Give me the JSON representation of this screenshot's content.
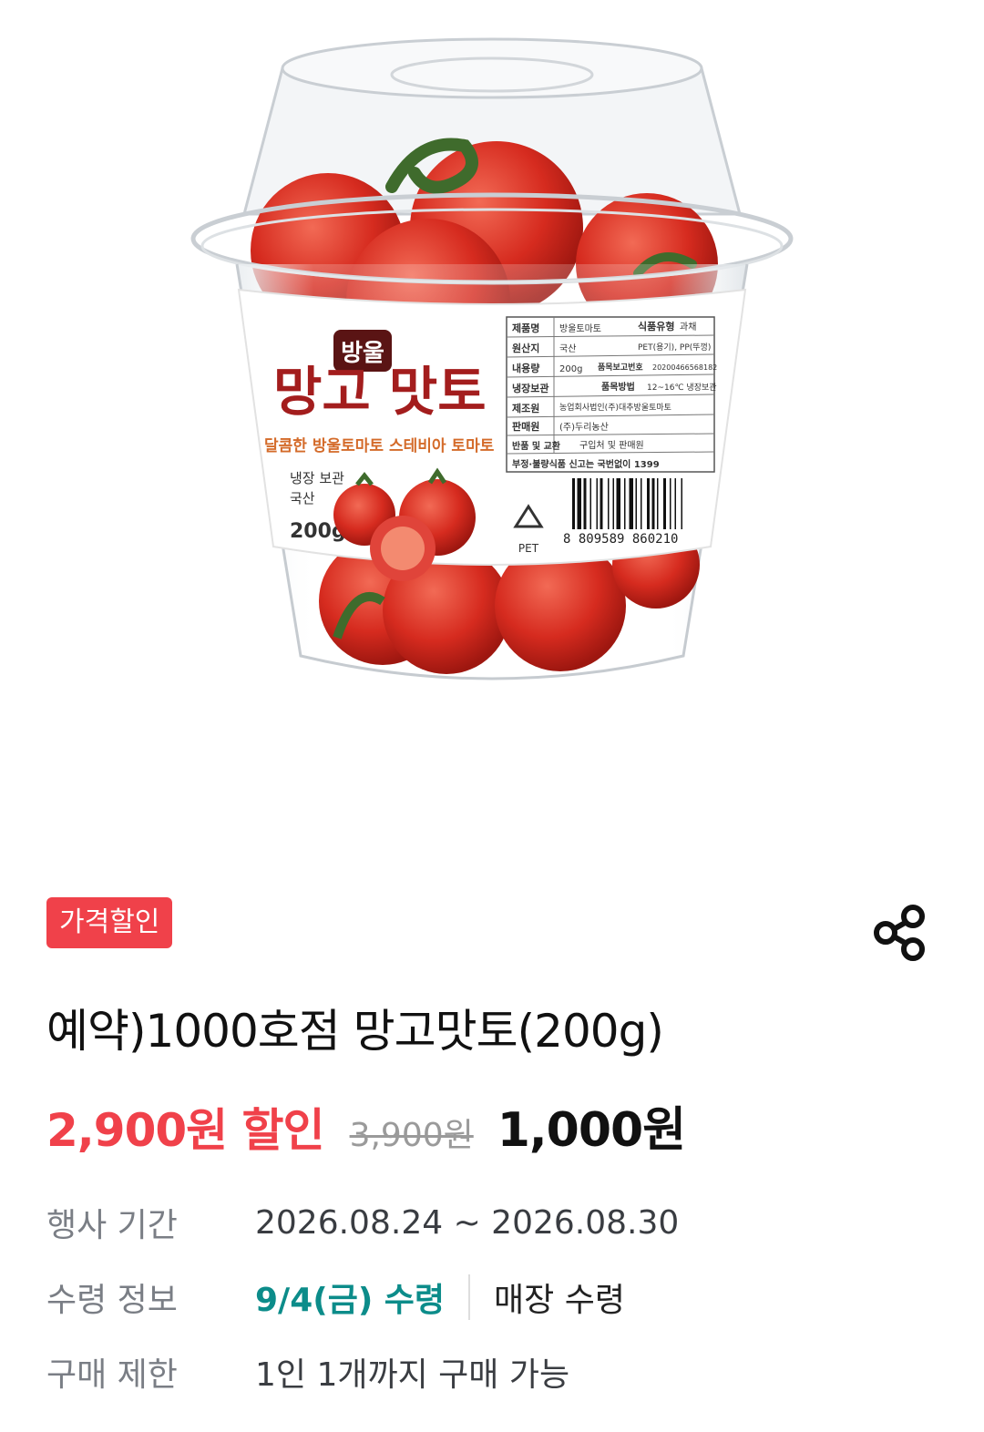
{
  "product_image": {
    "alt": "방울 망고 맛토 200g",
    "label": {
      "small_title": "방울",
      "brand": "망고 맛토",
      "tagline": "달콤한 방울토마토 스테비아 토마토",
      "storage": "냉장 보관",
      "origin": "국산",
      "weight": "200g",
      "barcode_number": "8 809589 860210",
      "recycle_mark": "PET",
      "info_table": [
        [
          "제품명",
          "방울토마토",
          "식품유형",
          "과채"
        ],
        [
          "원산지",
          "국산",
          "",
          "PET(용기), PP(뚜껑)"
        ],
        [
          "내용량",
          "200g",
          "품목보고번호",
          "20200466568182"
        ],
        [
          "냉장보관",
          "",
          "품목방법",
          "12~16℃ 냉장보관"
        ],
        [
          "제조원",
          "농업회사법인(주)대추방울토마토",
          "",
          ""
        ],
        [
          "판매원",
          "(주)두리농산",
          "",
          ""
        ],
        [
          "반품 및 교환",
          "구입처 및 판매원",
          "",
          ""
        ],
        [
          "부정·불량식품 신고는 국번없이 1399",
          "",
          "",
          ""
        ]
      ]
    }
  },
  "badge": "가격할인",
  "share_icon": "share-icon",
  "title": "예약)1000호점 망고맛토(200g)",
  "price": {
    "discount": "2,900원 할인",
    "original": "3,900원",
    "final": "1,000원"
  },
  "info": {
    "period_label": "행사 기간",
    "period_value": "2026.08.24 ~ 2026.08.30",
    "pickup_label": "수령 정보",
    "pickup_date": "9/4(금) 수령",
    "pickup_place": "매장 수령",
    "limit_label": "구매 제한",
    "limit_value": "1인 1개까지 구매 가능"
  },
  "colors": {
    "accent_red": "#f0414a",
    "pickup_teal": "#0c8c8a",
    "label_gray": "#7a7e85"
  }
}
